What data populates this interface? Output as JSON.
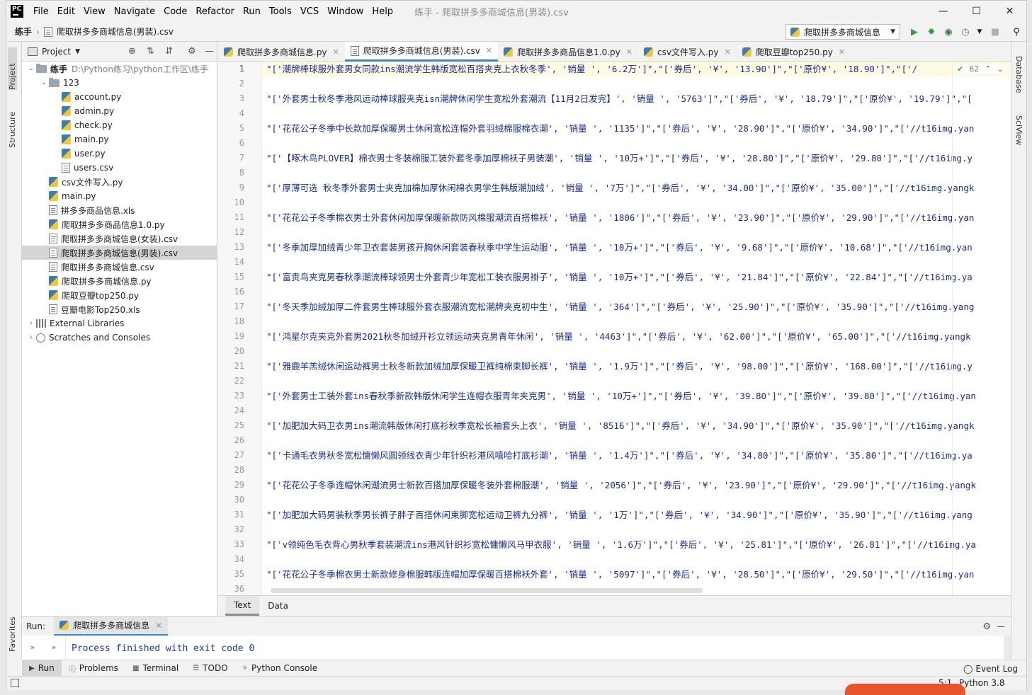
{
  "menu": [
    "File",
    "Edit",
    "View",
    "Navigate",
    "Code",
    "Refactor",
    "Run",
    "Tools",
    "VCS",
    "Window",
    "Help"
  ],
  "window_title": "练手 - 爬取拼多多商城信息(男装).csv",
  "breadcrumb": {
    "project": "练手",
    "file": "爬取拼多多商城信息(男装).csv"
  },
  "run_config": "爬取拼多多商城信息",
  "project_panel": {
    "title": "Project",
    "root": {
      "name": "练手",
      "path": "D:\\Python练习\\python工作区\\练手"
    },
    "tree": [
      {
        "label": "123",
        "kind": "folder",
        "level": 1,
        "arrow": "⌄"
      },
      {
        "label": "account.py",
        "kind": "py",
        "level": 2
      },
      {
        "label": "admin.py",
        "kind": "py",
        "level": 2
      },
      {
        "label": "check.py",
        "kind": "py",
        "level": 2
      },
      {
        "label": "main.py",
        "kind": "py",
        "level": 2
      },
      {
        "label": "user.py",
        "kind": "py",
        "level": 2
      },
      {
        "label": "users.csv",
        "kind": "csv",
        "level": 2
      },
      {
        "label": "csv文件写入.py",
        "kind": "py",
        "level": 1
      },
      {
        "label": "main.py",
        "kind": "py",
        "level": 1
      },
      {
        "label": "拼多多商品信息.xls",
        "kind": "csv",
        "level": 1
      },
      {
        "label": "爬取拼多多商品信息1.0.py",
        "kind": "py",
        "level": 1
      },
      {
        "label": "爬取拼多多商城信息(女装).csv",
        "kind": "csv",
        "level": 1
      },
      {
        "label": "爬取拼多多商城信息(男装).csv",
        "kind": "csv",
        "level": 1,
        "selected": true
      },
      {
        "label": "爬取拼多多商城信息.csv",
        "kind": "csv",
        "level": 1
      },
      {
        "label": "爬取拼多多商城信息.py",
        "kind": "py",
        "level": 1
      },
      {
        "label": "爬取豆瓣top250.py",
        "kind": "py",
        "level": 1
      },
      {
        "label": "豆瓣电影Top250.xls",
        "kind": "csv",
        "level": 1
      }
    ],
    "extra": [
      {
        "label": "External Libraries",
        "kind": "lib"
      },
      {
        "label": "Scratches and Consoles",
        "kind": "scr"
      }
    ]
  },
  "editor_tabs": [
    {
      "label": "爬取拼多多商城信息.py",
      "kind": "py"
    },
    {
      "label": "爬取拼多多商城信息(男装).csv",
      "kind": "csv",
      "active": true
    },
    {
      "label": "爬取拼多多商品信息1.0.py",
      "kind": "py"
    },
    {
      "label": "csv文件写入.py",
      "kind": "py"
    },
    {
      "label": "爬取豆瓣top250.py",
      "kind": "py"
    }
  ],
  "inspection_count": "62",
  "code_lines": [
    "\"['潮牌棒球服外套男女同款ins潮流学生韩版宽松百搭夹克上衣秋冬季', '销量 ', '6.2万']\",\"['券后', '¥', '13.90']\",\"['原价¥', '18.90']\",\"['/",
    "",
    "\"['外套男士秋冬季港风运动棒球服夹克isn潮牌休闲学生宽松外套潮流【11月2日发完】', '销量 ', '5763']\",\"['券后', '¥', '18.79']\",\"['原价¥', '19.79']\",\"[",
    "",
    "\"['花花公子冬季中长款加厚保暖男士休闲宽松连帽外套羽绒棉服棉衣潮', '销量 ', '1135']\",\"['券后', '¥', '28.90']\",\"['原价¥', '34.90']\",\"['//t16img.yan",
    "",
    "\"['【啄木鸟PLOVER】棉衣男士冬装棉服工装外套冬季加厚棉袄子男装潮', '销量 ', '10万+']\",\"['券后', '¥', '28.80']\",\"['原价¥', '29.80']\",\"['//t16img.y",
    "",
    "\"['厚薄可选 秋冬季外套男士夹克加棉加厚休闲棉衣男学生韩版潮加绒', '销量 ', '7万']\",\"['券后', '¥', '34.00']\",\"['原价¥', '35.00']\",\"['//t16img.yangk",
    "",
    "\"['花花公子冬季棉衣男士外套休闲加厚保暖新款防风棉服潮流百搭棉袄', '销量 ', '1806']\",\"['券后', '¥', '23.90']\",\"['原价¥', '29.90']\",\"['//t16img.yan",
    "",
    "\"['冬季加厚加绒青少年卫衣套装男孩开胸休闲套装春秋季中学生运动服', '销量 ', '10万+']\",\"['券后', '¥', '9.68']\",\"['原价¥', '10.68']\",\"['//t16img.yan",
    "",
    "\"['富贵鸟夹克男春秋季潮流棒球领男士外套青少年宽松工装衣服男褂子', '销量 ', '10万+']\",\"['券后', '¥', '21.84']\",\"['原价¥', '22.84']\",\"['//t16img.ya",
    "",
    "\"['冬天季加绒加厚二件套男生棒球服外套衣服潮流宽松潮牌夹克初中生', '销量 ', '364']\",\"['券后', '¥', '25.90']\",\"['原价¥', '35.90']\",\"['//t16img.yang",
    "",
    "\"['鸿星尔克夹克外套男2021秋冬加绒开衫立领运动夹克男青年休闲', '销量 ', '4463']\",\"['券后', '¥', '62.00']\",\"['原价¥', '65.00']\",\"['//t16img.yangk",
    "",
    "\"['雅鹿羊羔绒休闲运动裤男士秋冬新款加绒加厚保暖卫裤纯棉束脚长裤', '销量 ', '1.9万']\",\"['券后', '¥', '98.00']\",\"['原价¥', '168.00']\",\"['//t16img.y",
    "",
    "\"['外套男士工装外套ins春秋季新款韩版休闲学生连帽衣服青年夹克男', '销量 ', '10万+']\",\"['券后', '¥', '39.80']\",\"['原价¥', '39.80']\",\"['//t16img.yan",
    "",
    "\"['加肥加大码卫衣男ins潮流韩版休闲打底衫秋季宽松长袖套头上衣', '销量 ', '8516']\",\"['券后', '¥', '34.90']\",\"['原价¥', '35.90']\",\"['//t16img.yangk",
    "",
    "\"['卡通毛衣男秋冬宽松慵懒风圆领线衣青少年针织衫港风嘻哈打底衫潮', '销量 ', '1.4万']\",\"['券后', '¥', '34.80']\",\"['原价¥', '35.80']\",\"['//t16img.ya",
    "",
    "\"['花花公子冬季连帽休闲潮流男士新款百搭加厚保暖冬装外套棉服潮', '销量 ', '2056']\",\"['券后', '¥', '23.90']\",\"['原价¥', '29.90']\",\"['//t16img.yangk",
    "",
    "\"['加肥加大码男装秋季男长裤子胖子百搭休闲束脚宽松运动卫裤九分裤', '销量 ', '1万']\",\"['券后', '¥', '34.90']\",\"['原价¥', '35.90']\",\"['//t16img.yang",
    "",
    "\"['v领纯色毛衣背心男秋季套装潮流ins港风针织衫宽松慵懒风马甲衣服', '销量 ', '1.6万']\",\"['券后', '¥', '25.81']\",\"['原价¥', '26.81']\",\"['//t16img.ya",
    "",
    "\"['花花公子冬季棉衣男士新款修身棉服韩版连帽加厚保暖百搭棉袄外套', '销量 ', '5097']\",\"['券后', '¥', '28.50']\",\"['原价¥', '29.50']\",\"['//t16img.yan",
    ""
  ],
  "editor_bottom_tabs": [
    "Text",
    "Data"
  ],
  "left_strip": [
    "Project",
    "Structure",
    "Favorites"
  ],
  "right_strip": [
    "Database",
    "SciView"
  ],
  "run_panel": {
    "label": "Run:",
    "tab": "爬取拼多多商城信息",
    "output": "Process finished with exit code 0"
  },
  "tool_windows": [
    "Run",
    "Problems",
    "Terminal",
    "TODO",
    "Python Console"
  ],
  "event_log": "Event Log",
  "status": {
    "position": "5:1",
    "interpreter": "Python 3.8"
  },
  "colors": {
    "accent": "#4083c9",
    "code_string": "#1a2c8c",
    "current_line": "#fffae3"
  }
}
